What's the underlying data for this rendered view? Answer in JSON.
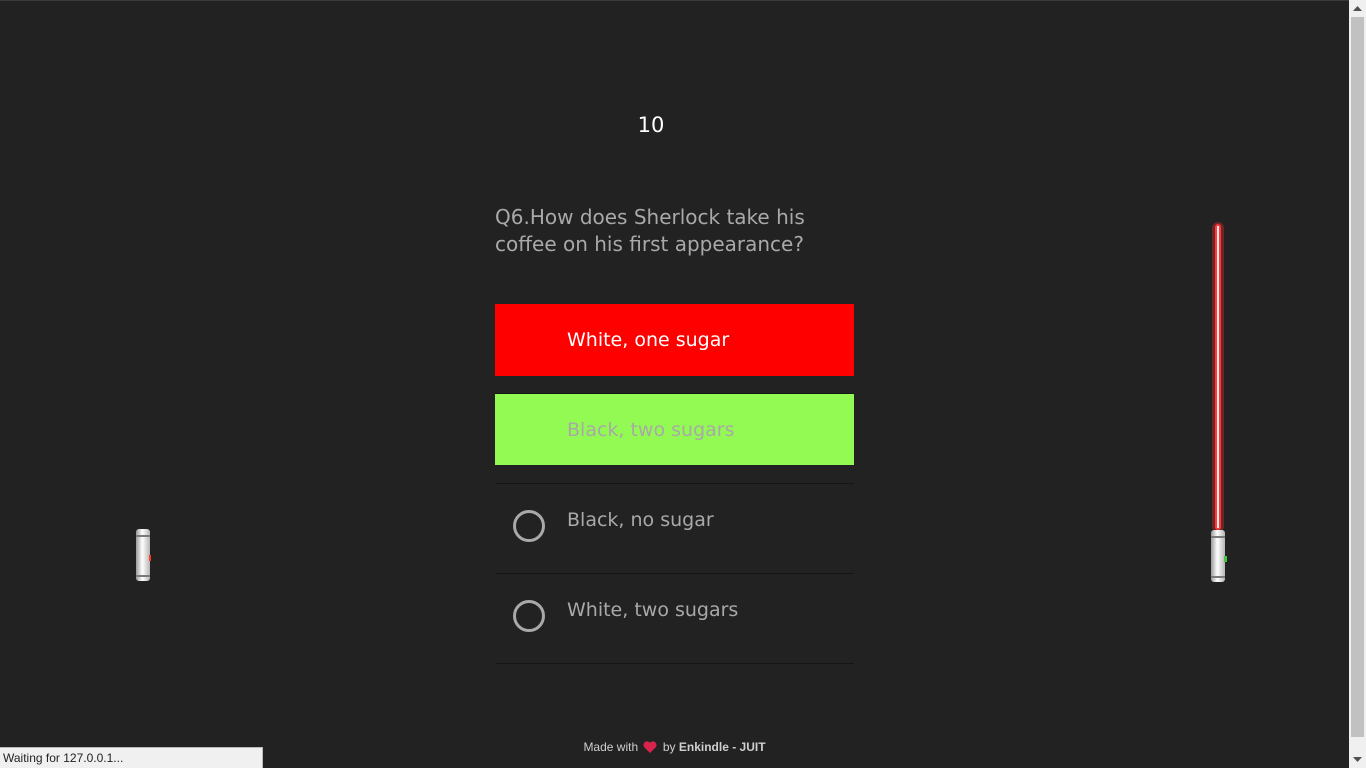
{
  "timer": {
    "value": "10"
  },
  "question": {
    "text": "Q6.How does Sherlock take his coffee on his first appearance?"
  },
  "options": [
    {
      "label": "White, one sugar",
      "state": "wrong",
      "color": "#ff0000",
      "text_color": "#ffffff"
    },
    {
      "label": "Black, two sugars",
      "state": "correct",
      "color": "#92fa52",
      "text_color": "#a9a9a9"
    },
    {
      "label": "Black, no sugar",
      "state": "unselected"
    },
    {
      "label": "White, two sugars",
      "state": "unselected"
    }
  ],
  "footer": {
    "made_with": "Made with",
    "by": "by",
    "author": "Enkindle - JUIT",
    "heart_icon": "heart-icon",
    "heart_color": "#d8244c"
  },
  "status": {
    "text": "Waiting for 127.0.0.1..."
  },
  "colors": {
    "background": "#222222",
    "question_text": "#a9a9a9",
    "saber_blade": "#ff2a2a"
  }
}
